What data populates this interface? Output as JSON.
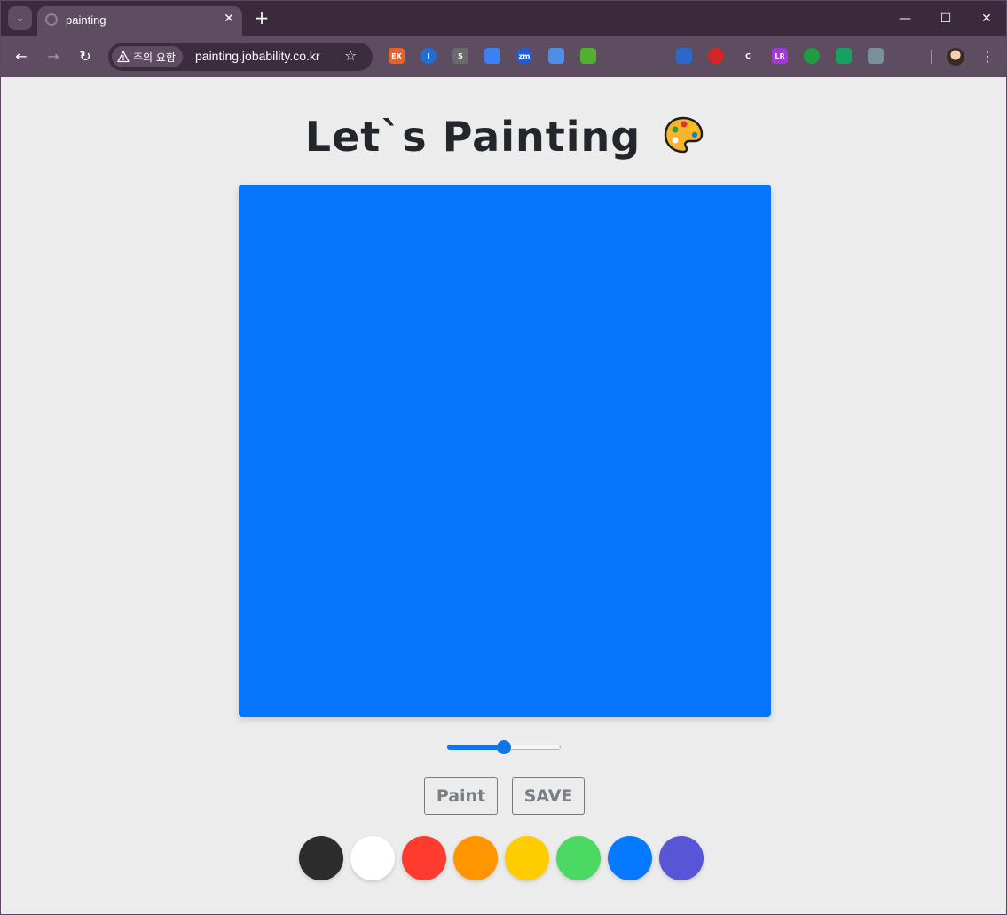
{
  "browser": {
    "tab_title": "painting",
    "security_chip": "주의 요함",
    "url": "painting.jobability.co.kr",
    "extensions": [
      {
        "name": "ex-extension-icon",
        "text": "EX",
        "color": "#e8622a"
      },
      {
        "name": "password-manager-icon",
        "text": "I",
        "color": "#1d6fd6"
      },
      {
        "name": "s-extension-icon",
        "text": "S",
        "color": "#6b6b6b"
      },
      {
        "name": "graduation-cap-icon",
        "text": "",
        "color": "#3b82f6"
      },
      {
        "name": "zoom-extension-icon",
        "text": "zm",
        "color": "#1f5ce0"
      },
      {
        "name": "link-icon",
        "text": "",
        "color": "#4d8fe6"
      },
      {
        "name": "play-circle-icon",
        "text": "",
        "color": "#51b030"
      },
      {
        "name": "react-icon",
        "text": "",
        "color": "#5e4c61"
      },
      {
        "name": "gear-icon",
        "text": "",
        "color": "#5e4c61"
      },
      {
        "name": "pen-icon",
        "text": "",
        "color": "#2b68c9"
      },
      {
        "name": "fast-forward-icon",
        "text": "",
        "color": "#d42525"
      },
      {
        "name": "code-extension-icon",
        "text": "C",
        "color": "#5e4c61"
      },
      {
        "name": "lr-extension-icon",
        "text": "LR",
        "color": "#a338d6"
      },
      {
        "name": "screen-extension-icon",
        "text": "",
        "color": "#1e9d42"
      },
      {
        "name": "chat-extension-icon",
        "text": "",
        "color": "#18a060"
      },
      {
        "name": "globe-extension-icon",
        "text": "",
        "color": "#78909c"
      },
      {
        "name": "puzzle-icon",
        "text": "",
        "color": "#5e4c61"
      }
    ]
  },
  "page": {
    "title": "Let`s Painting",
    "canvas_color": "#0677fd",
    "brush_size_fraction": 0.5,
    "buttons": {
      "paint_label": "Paint",
      "save_label": "SAVE"
    },
    "colors": [
      "#2c2c2c",
      "#ffffff",
      "#ff3b30",
      "#ff9500",
      "#ffcc00",
      "#4cd963",
      "#0579ff",
      "#5856d6"
    ]
  }
}
